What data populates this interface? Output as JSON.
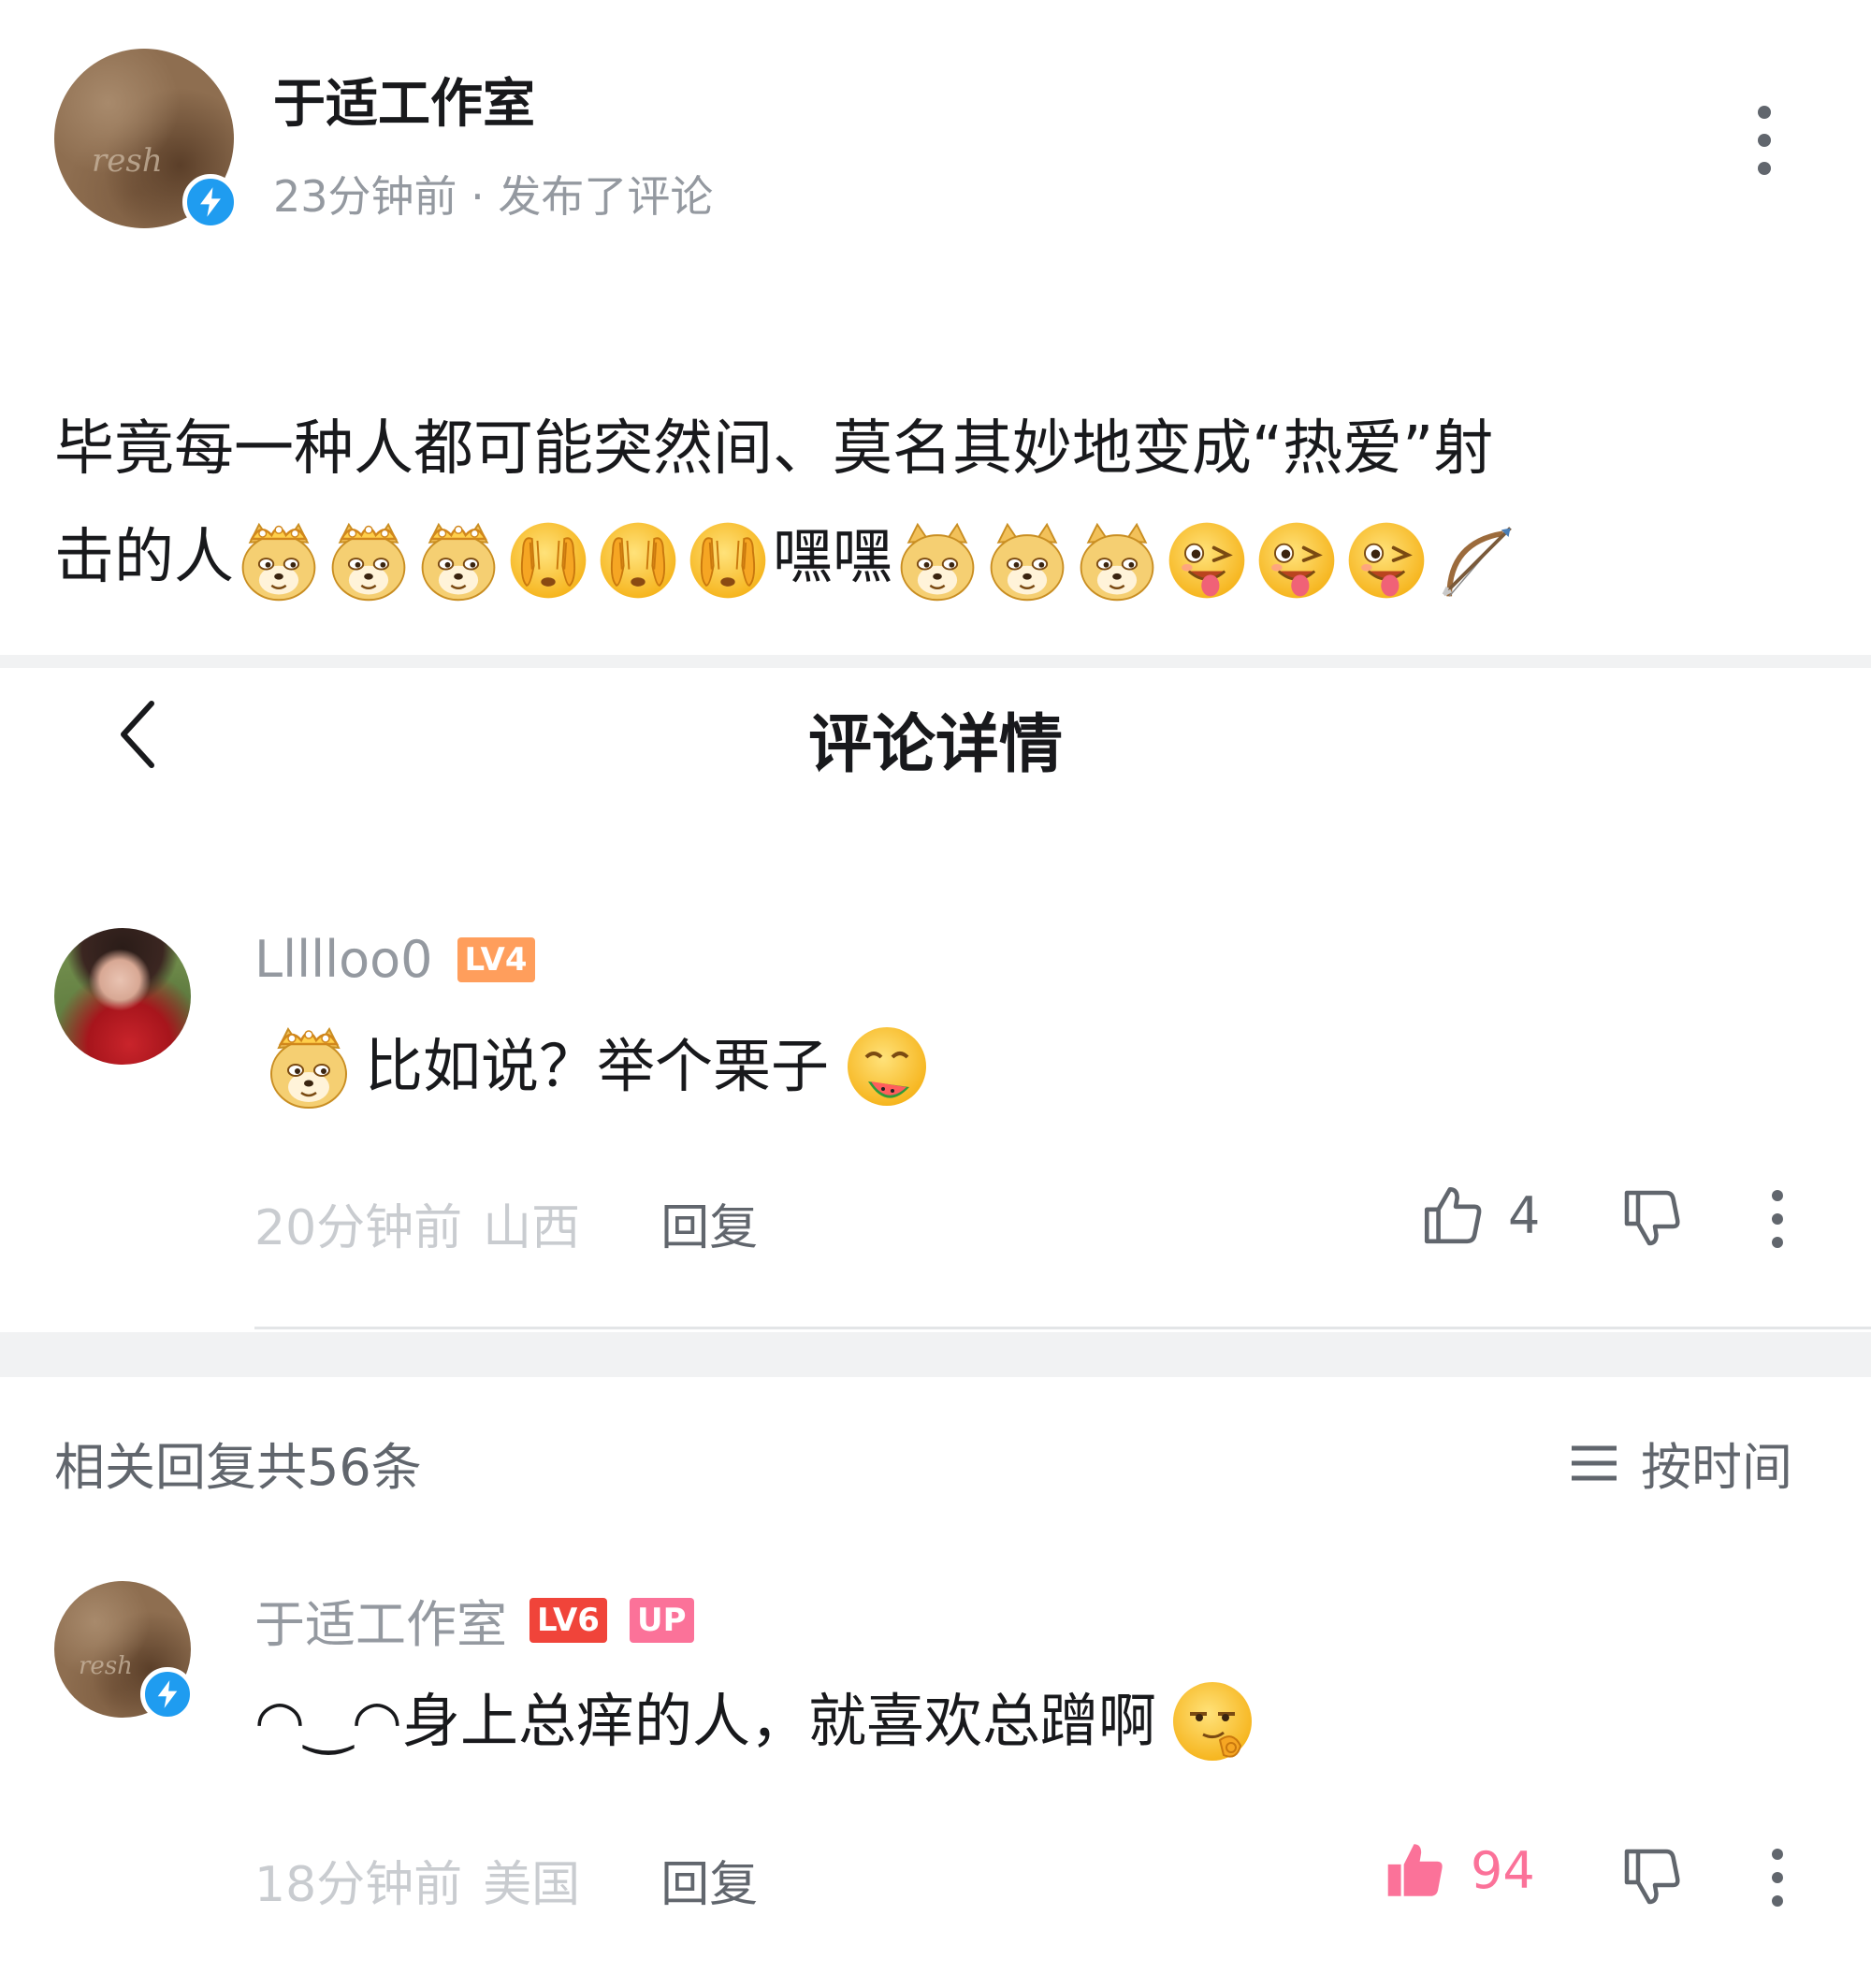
{
  "post": {
    "author": "于适工作室",
    "avatar_signature": "resh",
    "meta": "23分钟前 · 发布了评论",
    "text_line1": "毕竟每一种人都可能突然间、莫名其妙地变成“热爱”射",
    "text_line2_prefix": "击的人",
    "text_line2_middle": "嘿嘿",
    "emoji_icons": [
      "doge-crown-emoji",
      "facepalm-cover-emoji",
      "doge-emoji",
      "wink-tongue-emoji",
      "bow-arrow-emoji"
    ]
  },
  "header": {
    "title": "评论详情",
    "back_icon": "chevron-left-icon"
  },
  "root_comment": {
    "username": "Llllloo0",
    "level": "LV4",
    "text_main": "比如说？举个栗子",
    "time": "20分钟前",
    "location": "山西",
    "reply_label": "回复",
    "like_count": "4"
  },
  "replies_header": {
    "count_label": "相关回复共56条",
    "sort_label": "按时间"
  },
  "reply": {
    "username": "于适工作室",
    "level": "LV6",
    "up_badge": "UP",
    "prefix": "◠‿◠",
    "text_main": "身上总痒的人，就喜欢总蹭啊",
    "time": "18分钟前",
    "location": "美国",
    "reply_label": "回复",
    "like_count": "94"
  },
  "colors": {
    "accent_pink": "#fb7299",
    "verified_blue": "#1f9cf0",
    "lv4_orange": "#ff9e5c",
    "lv6_red": "#f0443a"
  }
}
